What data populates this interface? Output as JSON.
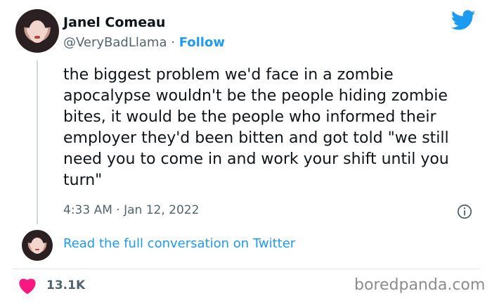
{
  "author": {
    "name": "Janel Comeau",
    "handle": "@VeryBadLlama",
    "separator": "·",
    "follow_label": "Follow"
  },
  "tweet": {
    "text": "the biggest problem we'd face in a zombie apocalypse wouldn't be the people hiding zombie bites, it would be the people who informed their employer they'd been bitten and got told \"we still need you to come in and work your shift until you turn\"",
    "timestamp": "4:33 AM · Jan 12, 2022"
  },
  "conversation": {
    "link_label": "Read the full conversation on Twitter"
  },
  "engagement": {
    "likes": "13.1K"
  },
  "watermark": "boredpanda.com",
  "icons": {
    "brand": "twitter-bird-icon",
    "info": "info-icon",
    "like": "heart-icon"
  },
  "colors": {
    "accent": "#1d9bf0",
    "heart": "#f91880",
    "text": "#0f1419",
    "muted": "#536471"
  }
}
